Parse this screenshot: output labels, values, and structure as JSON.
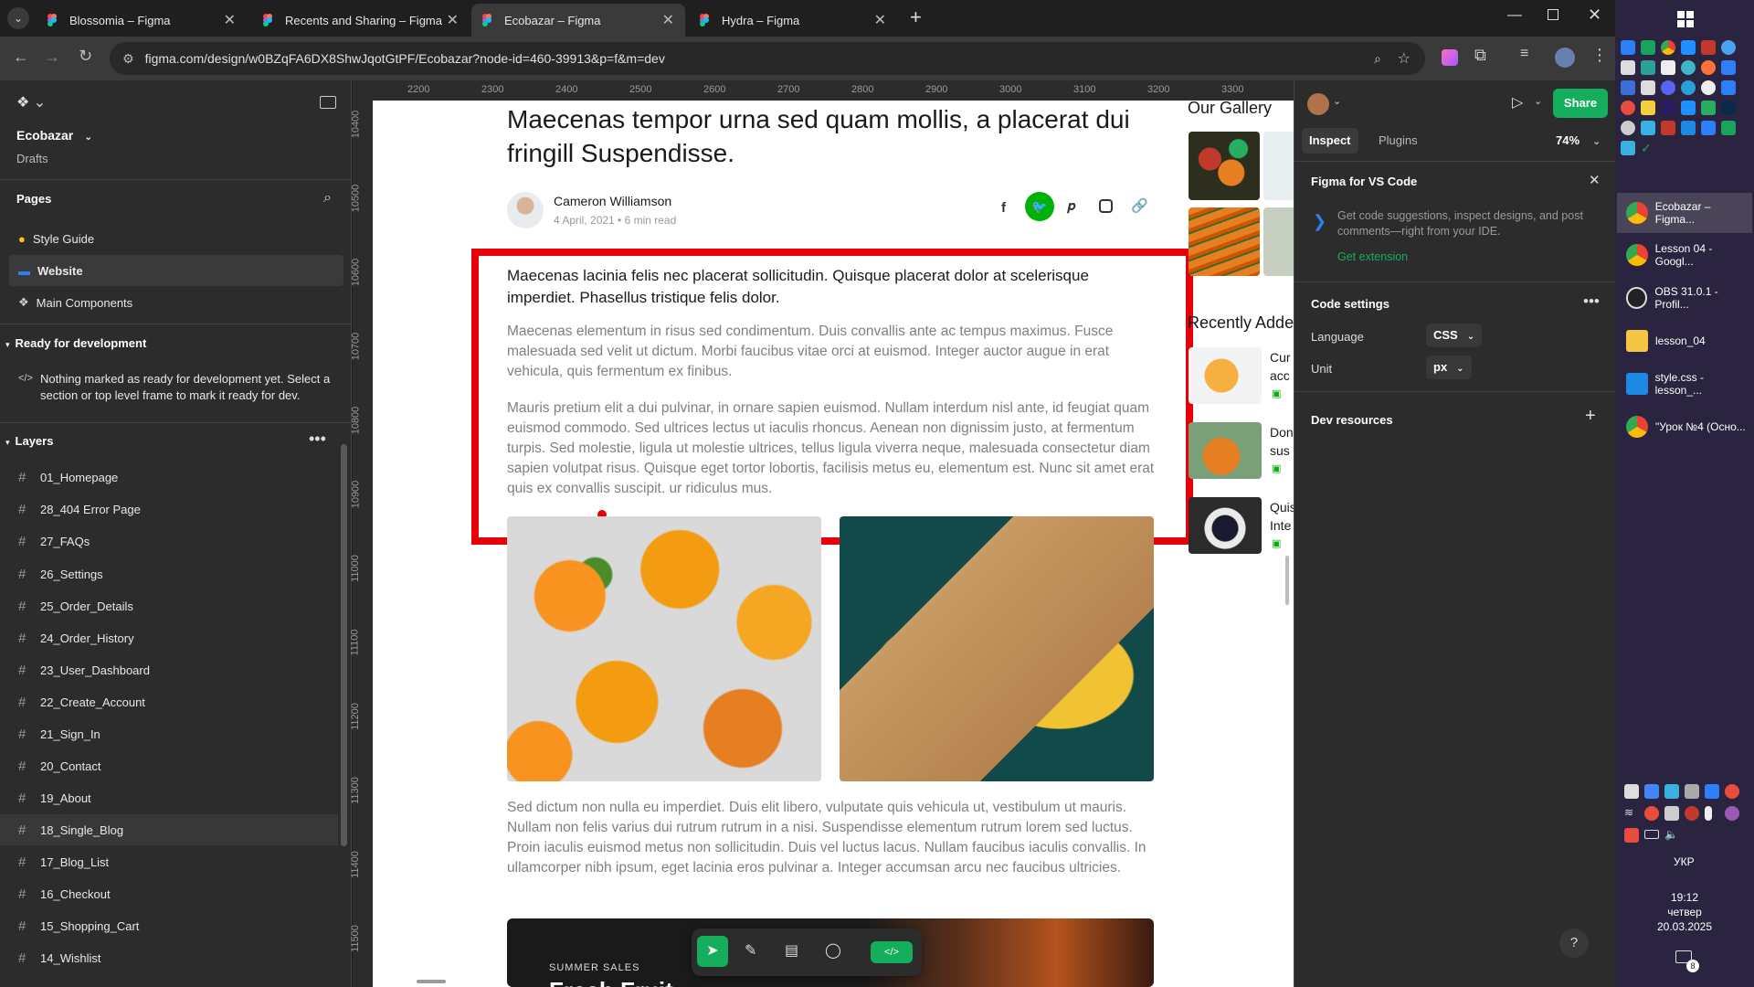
{
  "browser": {
    "tabs": [
      {
        "title": "Blossomia – Figma",
        "active": false
      },
      {
        "title": "Recents and Sharing – Figma",
        "active": false
      },
      {
        "title": "Ecobazar – Figma",
        "active": true
      },
      {
        "title": "Hydra – Figma",
        "active": false
      }
    ],
    "url": "figma.com/design/w0BZqFA6DX8ShwJqotGtPF/Ecobazar?node-id=460-39913&p=f&m=dev"
  },
  "left": {
    "project": "Ecobazar",
    "drafts": "Drafts",
    "pages_title": "Pages",
    "pages": [
      "Style Guide",
      "Website",
      "Main Components"
    ],
    "ready_title": "Ready for development",
    "ready_msg": "Nothing marked as ready for development yet. Select a section or top level frame to mark it ready for dev.",
    "layers_title": "Layers",
    "layers": [
      "01_Homepage",
      "28_404 Error Page",
      "27_FAQs",
      "26_Settings",
      "25_Order_Details",
      "24_Order_History",
      "23_User_Dashboard",
      "22_Create_Account",
      "21_Sign_In",
      "20_Contact",
      "19_About",
      "18_Single_Blog",
      "17_Blog_List",
      "16_Checkout",
      "15_Shopping_Cart",
      "14_Wishlist"
    ]
  },
  "ruler": {
    "h": [
      "2200",
      "2300",
      "2400",
      "2500",
      "2600",
      "2700",
      "2800",
      "2900",
      "3000",
      "3100",
      "3200",
      "3300"
    ],
    "v": [
      "10400",
      "10500",
      "10600",
      "10700",
      "10800",
      "10900",
      "11000",
      "11100",
      "11200",
      "11300",
      "11400",
      "11500"
    ]
  },
  "article": {
    "title": "Maecenas tempor urna sed quam mollis, a placerat dui fringill Suspendisse.",
    "author": "Cameron Williamson",
    "meta": "4 April, 2021  •  6 min read",
    "lead": "Maecenas lacinia felis nec placerat sollicitudin. Quisque placerat dolor at scelerisque imperdiet. Phasellus tristique felis dolor.",
    "p1": "Maecenas elementum in risus sed condimentum. Duis convallis ante ac tempus maximus. Fusce malesuada sed velit ut dictum. Morbi faucibus vitae orci at euismod. Integer auctor augue in erat vehicula, quis fermentum ex finibus.",
    "p2": "Mauris pretium elit a dui pulvinar, in ornare sapien euismod. Nullam interdum nisl ante, id feugiat quam euismod commodo. Sed ultrices lectus ut iaculis rhoncus. Aenean non dignissim justo, at fermentum turpis. Sed molestie, ligula ut molestie ultrices, tellus ligula viverra neque, malesuada consectetur diam sapien volutpat risus. Quisque eget tortor lobortis, facilisis metus eu, elementum est. Nunc sit amet erat quis ex convallis suscipit. ur ridiculus mus.",
    "p3": "Sed dictum non nulla eu imperdiet. Duis elit libero, vulputate quis vehicula ut, vestibulum ut mauris. Nullam non felis varius dui rutrum rutrum in a nisi. Suspendisse elementum rutrum lorem sed luctus. Proin iaculis euismod metus non sollicitudin. Duis vel luctus lacus. Nullam faucibus iaculis convallis. In ullamcorper nibh ipsum, eget lacinia eros pulvinar a. Integer accumsan arcu nec faucibus ultricies.",
    "banner_tag": "SUMMER SALES",
    "banner_title": "Fresh Fruit"
  },
  "sidebar_site": {
    "gallery": "Our Gallery",
    "recent": "Recently Added",
    "recent_items": [
      "Cur acc",
      "Don sus",
      "Quis Inte"
    ]
  },
  "right": {
    "tab_inspect": "Inspect",
    "tab_plugins": "Plugins",
    "zoom": "74%",
    "share": "Share",
    "vs_title": "Figma for VS Code",
    "vs_desc": "Get code suggestions, inspect designs, and post comments—right from your IDE.",
    "vs_link": "Get extension",
    "code_title": "Code settings",
    "lang_label": "Language",
    "lang_value": "CSS",
    "unit_label": "Unit",
    "unit_value": "px",
    "dev_res": "Dev resources",
    "help": "?"
  },
  "taskbar": {
    "windows": [
      "Ecobazar – Figma...",
      "Lesson 04 - Googl...",
      "OBS 31.0.1 - Profil...",
      "lesson_04",
      "style.css - lesson_...",
      "\"Урок №4 (Осно..."
    ],
    "lang": "УКР",
    "time": "19:12",
    "day": "четвер",
    "date": "20.03.2025",
    "notif": "8"
  },
  "colors": {
    "accent_green": "#00b207",
    "figma_green": "#14ae5c",
    "red_selection": "#e8000b"
  }
}
